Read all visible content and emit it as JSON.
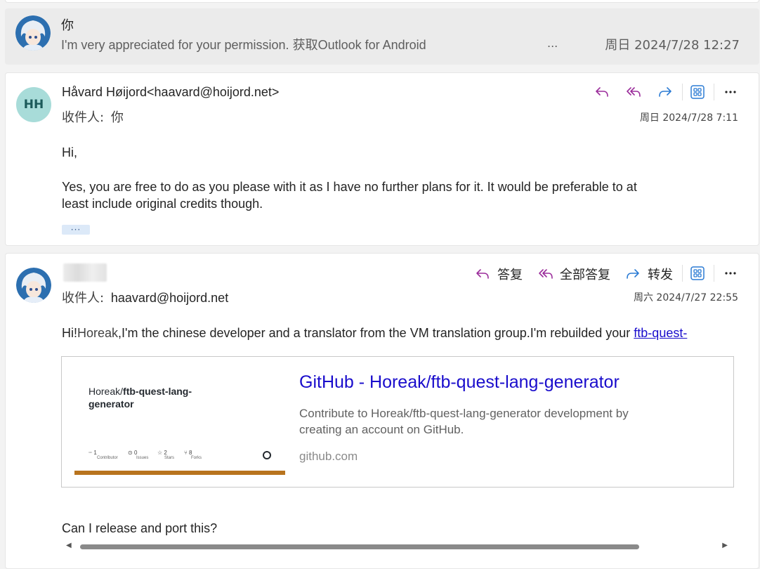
{
  "collapsed_message": {
    "sender": "你",
    "preview": "I'm very appreciated for your permission. 获取Outlook for Android",
    "ellipsis": "...",
    "date": "周日 2024/7/28 12:27"
  },
  "message1": {
    "avatar_initials": "HH",
    "sender": "Håvard Høijord<haavard@hoijord.net>",
    "to_label": "收件人:",
    "to_value": "你",
    "date": "周日 2024/7/28 7:11",
    "body_greeting": "Hi,",
    "body_line1": "Yes, you are free to do as you please with it as I have no further plans for it. It would be preferable to at",
    "body_line2": "least include original credits though.",
    "show_more": "···"
  },
  "message2": {
    "reply_label": "答复",
    "reply_all_label": "全部答复",
    "forward_label": "转发",
    "to_label": "收件人:",
    "to_value": "haavard@hoijord.net",
    "date": "周六 2024/7/27 22:55",
    "body_hi": "Hi!",
    "body_name": "Horeak",
    "body_rest": ",I'm the chinese developer and a translator from the VM translation group.I'm rebuilded your ",
    "body_link": "ftb-quest-",
    "closing": "Can I release and port this?"
  },
  "link_preview": {
    "title": "GitHub - Horeak/ftb-quest-lang-generator",
    "description_line1": "Contribute to Horeak/ftb-quest-lang-generator development by",
    "description_line2": "creating an account on GitHub.",
    "domain": "github.com",
    "thumb_owner": "Horeak/",
    "thumb_repo1": "ftb-quest-lang-",
    "thumb_repo2": "generator",
    "thumb_stats": [
      {
        "num": "1",
        "label": "Contributor",
        "icon": "people-icon"
      },
      {
        "num": "0",
        "label": "Issues",
        "icon": "issue-icon"
      },
      {
        "num": "2",
        "label": "Stars",
        "icon": "star-icon"
      },
      {
        "num": "8",
        "label": "Forks",
        "icon": "fork-icon"
      }
    ],
    "thumb_bar_color": "#b8741e"
  },
  "colors": {
    "reply_icon": "#9b2d9b",
    "forward_icon": "#2b7bd4",
    "apps_icon": "#2b7bd4",
    "link": "#1a0dcc",
    "initials_avatar_bg": "#a8dcd9"
  }
}
